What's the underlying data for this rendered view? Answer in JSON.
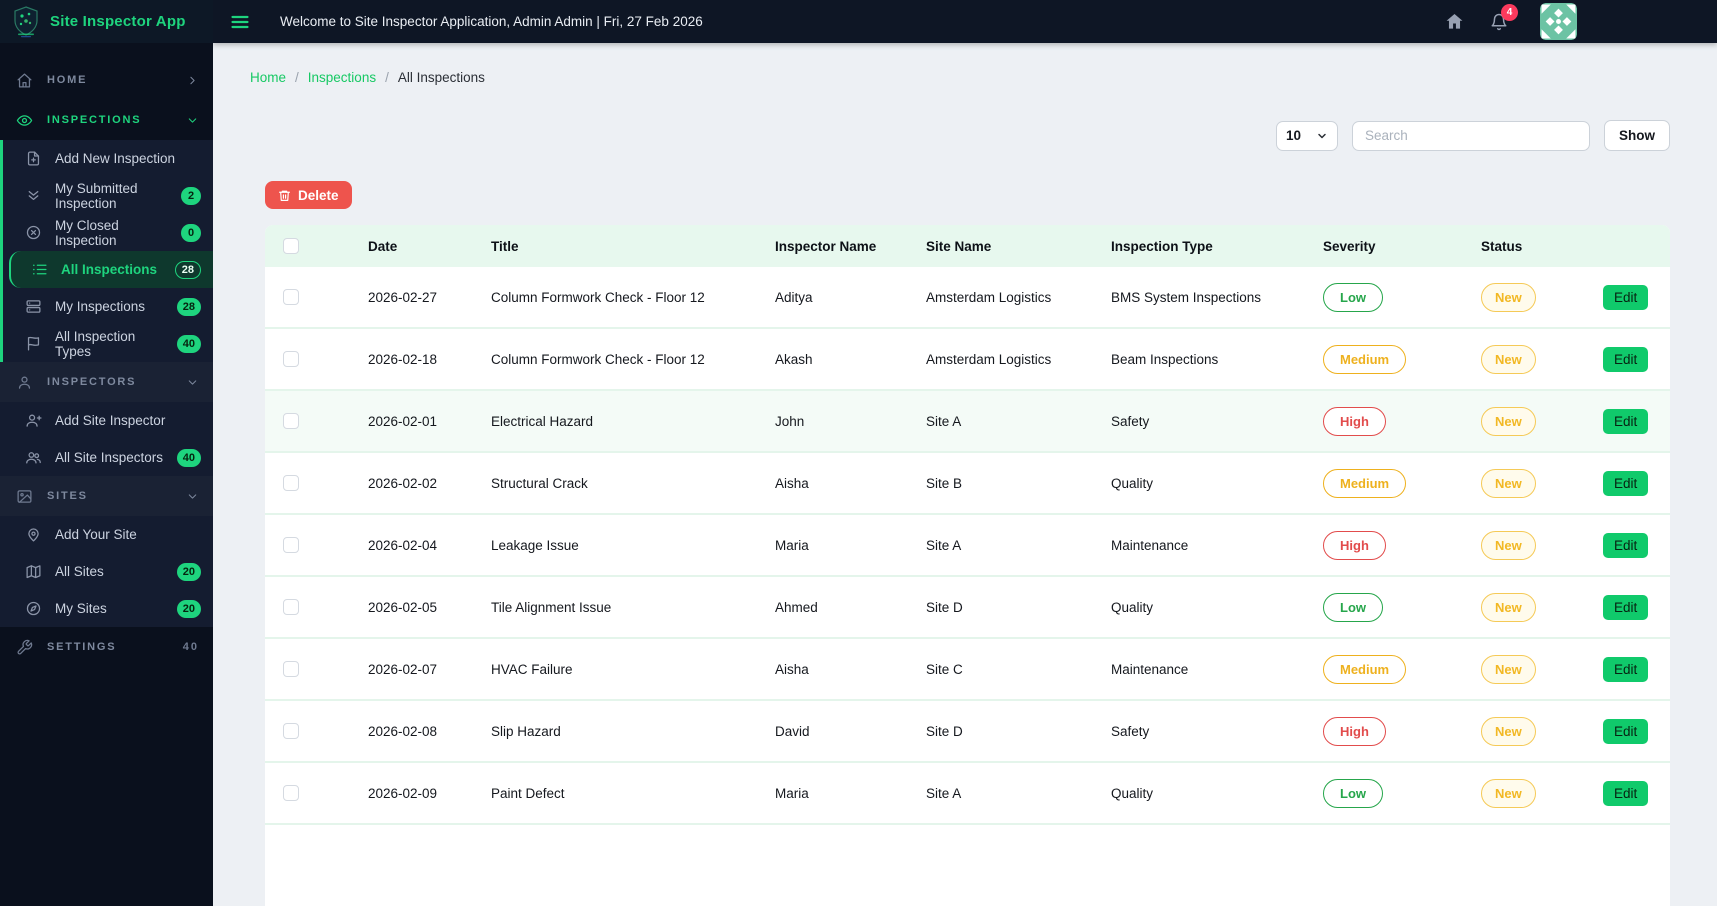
{
  "app": {
    "title": "Site Inspector App"
  },
  "topbar": {
    "welcome": "Welcome to Site Inspector Application, Admin Admin | Fri, 27 Feb 2026",
    "notification_count": "4",
    "icons": [
      "menu-icon",
      "home-icon",
      "bell-icon",
      "user-avatar"
    ]
  },
  "breadcrumb": {
    "items": [
      "Home",
      "Inspections",
      "All Inspections"
    ]
  },
  "controls": {
    "page_size": "10",
    "search_placeholder": "Search",
    "show_label": "Show"
  },
  "actions": {
    "delete_label": "Delete"
  },
  "sidebar": {
    "sections": [
      {
        "type": "header",
        "id": "home",
        "icon": "home-icon",
        "label": "HOME",
        "chevron": "right"
      },
      {
        "type": "header",
        "id": "inspections",
        "icon": "eye-icon",
        "label": "INSPECTIONS",
        "chevron": "down",
        "active": true
      },
      {
        "type": "group",
        "accent": true,
        "items": [
          {
            "icon": "file-plus-icon",
            "label": "Add New Inspection"
          },
          {
            "icon": "double-chevron-icon",
            "label": "My Submitted Inspection",
            "badge": "2"
          },
          {
            "icon": "circle-x-icon",
            "label": "My Closed Inspection",
            "badge": "0"
          },
          {
            "icon": "list-icon",
            "label": "All Inspections",
            "badge": "28",
            "active": true
          },
          {
            "icon": "stack-icon",
            "label": "My Inspections",
            "badge": "28"
          },
          {
            "icon": "flag-icon",
            "label": "All Inspection Types",
            "badge": "40"
          }
        ]
      },
      {
        "type": "header",
        "id": "inspectors",
        "icon": "user-icon",
        "label": "INSPECTORS",
        "chevron": "down",
        "shaded": true
      },
      {
        "type": "group",
        "items": [
          {
            "icon": "user-plus-icon",
            "label": "Add Site Inspector"
          },
          {
            "icon": "users-icon",
            "label": "All Site Inspectors",
            "badge": "40"
          }
        ]
      },
      {
        "type": "header",
        "id": "sites",
        "icon": "image-icon",
        "label": "SITES",
        "chevron": "down",
        "shaded": true
      },
      {
        "type": "group",
        "items": [
          {
            "icon": "pin-icon",
            "label": "Add Your Site"
          },
          {
            "icon": "map-icon",
            "label": "All Sites",
            "badge": "20"
          },
          {
            "icon": "compass-icon",
            "label": "My Sites",
            "badge": "20"
          }
        ]
      },
      {
        "type": "header",
        "id": "settings",
        "icon": "wrench-icon",
        "label": "SETTINGS",
        "right_text": "40"
      }
    ]
  },
  "table": {
    "headers": [
      "Date",
      "Title",
      "Inspector Name",
      "Site Name",
      "Inspection Type",
      "Severity",
      "Status"
    ],
    "edit_label": "Edit",
    "rows": [
      {
        "date": "2026-02-27",
        "title": "Column Formwork Check - Floor 12",
        "inspector": "Aditya",
        "site": "Amsterdam Logistics",
        "type": "BMS System Inspections",
        "severity": "Low",
        "status": "New"
      },
      {
        "date": "2026-02-18",
        "title": "Column Formwork Check - Floor 12",
        "inspector": "Akash",
        "site": "Amsterdam Logistics",
        "type": "Beam Inspections",
        "severity": "Medium",
        "status": "New"
      },
      {
        "date": "2026-02-01",
        "title": "Electrical Hazard",
        "inspector": "John",
        "site": "Site A",
        "type": "Safety",
        "severity": "High",
        "status": "New",
        "highlighted": true
      },
      {
        "date": "2026-02-02",
        "title": "Structural Crack",
        "inspector": "Aisha",
        "site": "Site B",
        "type": "Quality",
        "severity": "Medium",
        "status": "New"
      },
      {
        "date": "2026-02-04",
        "title": "Leakage Issue",
        "inspector": "Maria",
        "site": "Site A",
        "type": "Maintenance",
        "severity": "High",
        "status": "New"
      },
      {
        "date": "2026-02-05",
        "title": "Tile Alignment Issue",
        "inspector": "Ahmed",
        "site": "Site D",
        "type": "Quality",
        "severity": "Low",
        "status": "New"
      },
      {
        "date": "2026-02-07",
        "title": "HVAC Failure",
        "inspector": "Aisha",
        "site": "Site C",
        "type": "Maintenance",
        "severity": "Medium",
        "status": "New"
      },
      {
        "date": "2026-02-08",
        "title": "Slip Hazard",
        "inspector": "David",
        "site": "Site D",
        "type": "Safety",
        "severity": "High",
        "status": "New"
      },
      {
        "date": "2026-02-09",
        "title": "Paint Defect",
        "inspector": "Maria",
        "site": "Site A",
        "type": "Quality",
        "severity": "Low",
        "status": "New"
      }
    ]
  },
  "colors": {
    "accent": "#1ed47e",
    "sidebar_bg": "#0a101d",
    "sidebar_head_bg": "#0d1826",
    "submenu_bg": "#141c30",
    "section_shade": "#1a2234",
    "active_item_bg": "#0e382d",
    "topbar_bg": "#0e1625",
    "content_bg": "#edf0f4",
    "mint": "#e7f8ee",
    "row_line": "#e4f5eb",
    "tint_row": "#f4fbf7",
    "low": "#26a64b",
    "medium": "#eeb11e",
    "high": "#e24c4c",
    "status_new": "#f2b824",
    "status_new_bg": "#fffbec",
    "status_new_border": "#f5ca57",
    "delete_red": "#ee544d",
    "edit_green": "#10ca6b",
    "bell_badge": "#fb3a5d",
    "link_green": "#17c964",
    "text_dark": "#15181e"
  }
}
